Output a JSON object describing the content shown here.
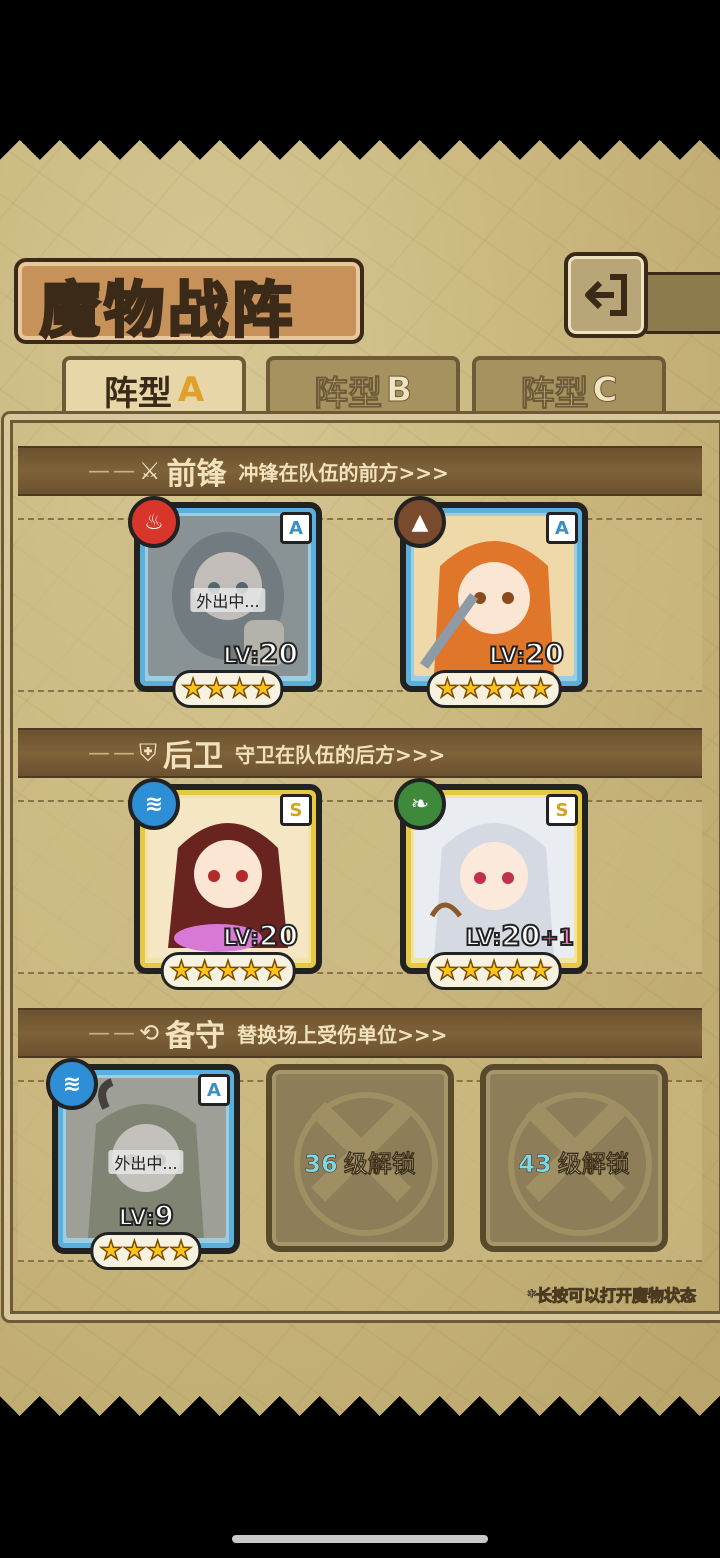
{
  "title": "魔物战阵",
  "tabs": [
    {
      "label": "阵型",
      "letter": "A"
    },
    {
      "label": "阵型",
      "letter": "B"
    },
    {
      "label": "阵型",
      "letter": "C"
    }
  ],
  "sections": {
    "front": {
      "name": "前锋",
      "desc": "冲锋在队伍的前方>>>"
    },
    "back": {
      "name": "后卫",
      "desc": "守卫在队伍的后方>>>"
    },
    "reserve": {
      "name": "备守",
      "desc": "替换场上受伤单位>>>"
    }
  },
  "units": {
    "front1": {
      "rank": "A",
      "element": "fire",
      "level_prefix": "LV:",
      "level": "20",
      "stars": 4,
      "status": "外出中..."
    },
    "front2": {
      "rank": "A",
      "element": "earth",
      "level_prefix": "LV:",
      "level": "20",
      "stars": 5
    },
    "back1": {
      "rank": "S",
      "element": "water",
      "level_prefix": "LV:",
      "level": "20",
      "stars": 5
    },
    "back2": {
      "rank": "S",
      "element": "wind",
      "level_prefix": "LV:",
      "level": "20",
      "bonus": "+1",
      "stars": 5
    },
    "reserve1": {
      "rank": "A",
      "element": "water",
      "level_prefix": "LV:",
      "level": "9",
      "stars": 4,
      "status": "外出中..."
    }
  },
  "locked_slots": [
    {
      "level": "36",
      "text": "级解锁"
    },
    {
      "level": "43",
      "text": "级解锁"
    }
  ],
  "hint": "*长按可以打开魔物状态",
  "colors": {
    "fire": "#d9362b",
    "earth": "#7a4a2c",
    "water": "#2e8fd6",
    "wind": "#3f8a3a"
  }
}
